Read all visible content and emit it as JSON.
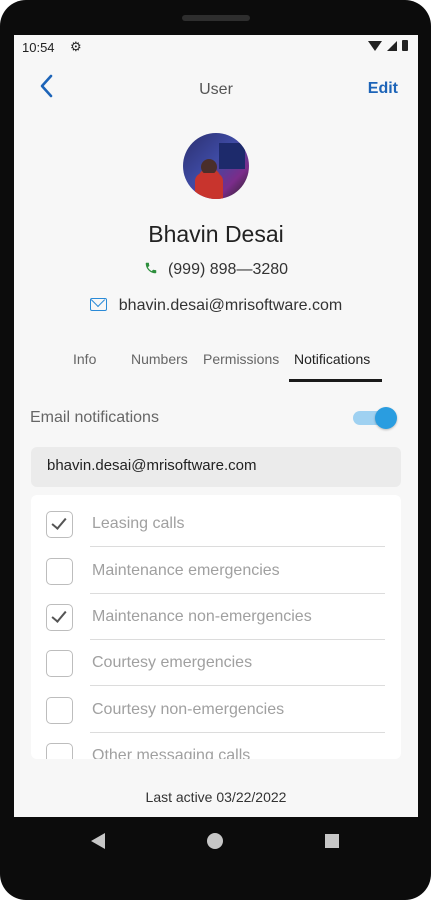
{
  "status_bar": {
    "time": "10:54",
    "settings_icon": "gear-icon"
  },
  "app_bar": {
    "back_icon": "chevron-left-icon",
    "title": "User",
    "edit_label": "Edit"
  },
  "profile": {
    "name": "Bhavin Desai",
    "phone": "(999) 898—3280",
    "email": "bhavin.desai@mrisoftware.com",
    "phone_icon": "phone-icon",
    "email_icon": "mail-icon"
  },
  "tabs": [
    {
      "label": "Info"
    },
    {
      "label": "Numbers"
    },
    {
      "label": "Permissions"
    },
    {
      "label": "Notifications",
      "active": true
    }
  ],
  "notifications": {
    "email_label": "Email notifications",
    "email_enabled": true,
    "email_value": "bhavin.desai@mrisoftware.com",
    "items": [
      {
        "label": "Leasing calls",
        "checked": true
      },
      {
        "label": "Maintenance emergencies",
        "checked": false
      },
      {
        "label": "Maintenance non-emergencies",
        "checked": true
      },
      {
        "label": "Courtesy emergencies",
        "checked": false
      },
      {
        "label": "Courtesy non-emergencies",
        "checked": false
      },
      {
        "label": "Other messaging calls",
        "checked": false
      }
    ]
  },
  "footer": {
    "last_active": "Last active 03/22/2022"
  },
  "colors": {
    "accent": "#1d64b8",
    "toggle": "#2a9de0",
    "phone_icon": "#2e8f3d",
    "mail_icon": "#2a8ad7"
  }
}
